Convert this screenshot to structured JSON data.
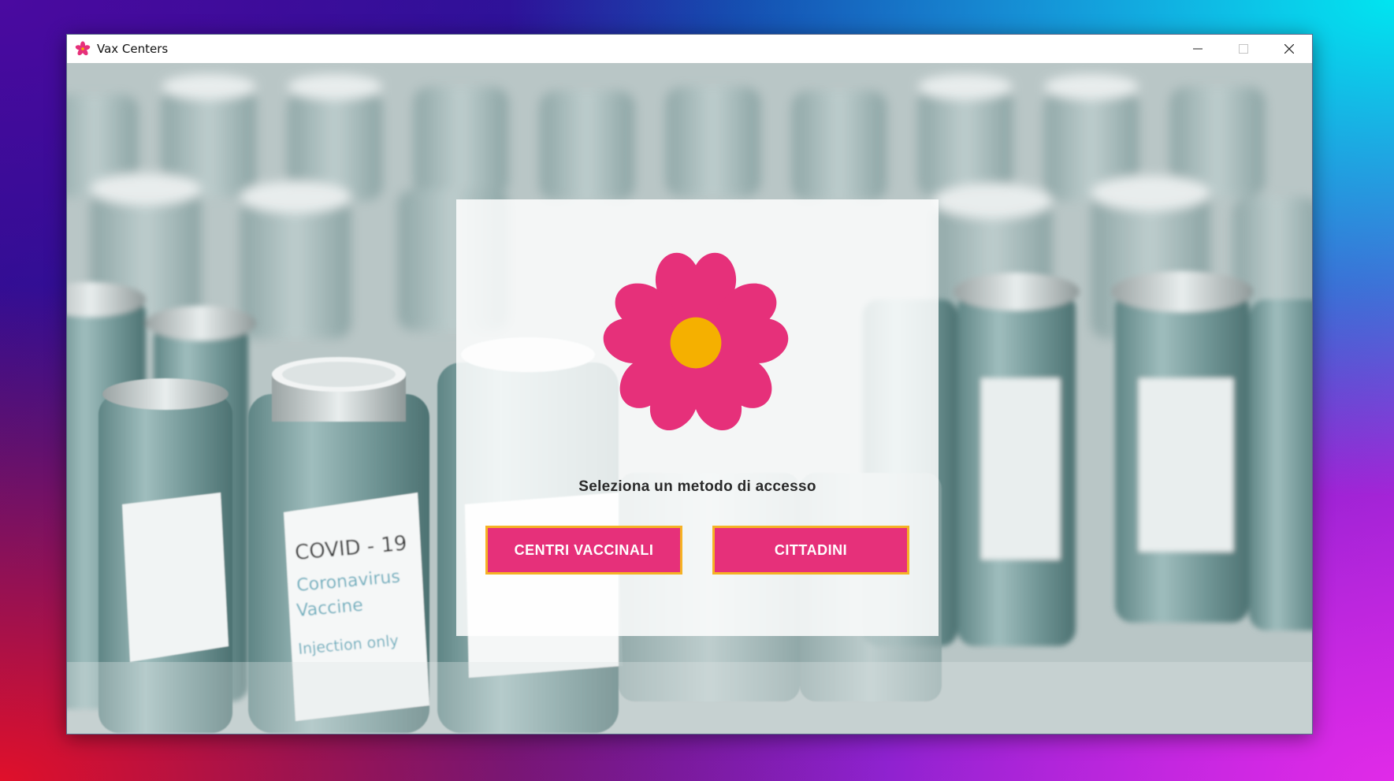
{
  "window": {
    "title": "Vax Centers",
    "icon": "flower-icon",
    "controls": {
      "minimize": "—",
      "maximize": "☐",
      "close": "✕"
    }
  },
  "background": {
    "description_labels": {
      "vial_text_1": "COVID - 19",
      "vial_text_2": "Coronavirus",
      "vial_text_3": "Vaccine",
      "vial_text_4": "Injection only"
    }
  },
  "login": {
    "logo_icon": "flower-logo-icon",
    "prompt": "Seleziona un metodo di accesso",
    "buttons": {
      "centri": "CENTRI VACCINALI",
      "cittadini": "CITTADINI"
    }
  },
  "colors": {
    "accent_pink": "#e6307a",
    "accent_orange": "#f5b225",
    "flower_center": "#f5b000"
  }
}
